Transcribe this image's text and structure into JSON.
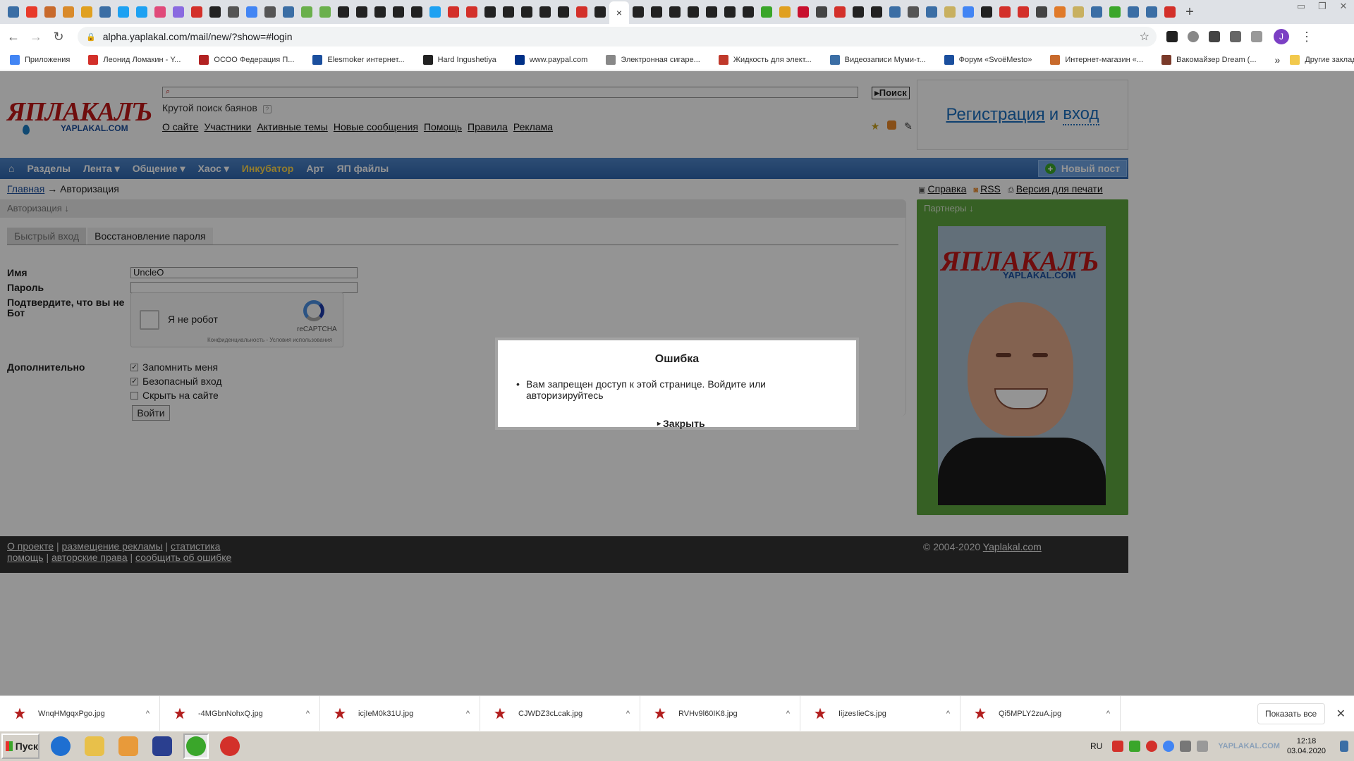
{
  "browser": {
    "close_tab_glyph": "×",
    "new_tab_glyph": "+",
    "url": "alpha.yaplakal.com/mail/new/?show=#login",
    "profile_initial": "J",
    "tab_favicon_colors": [
      "#3b6ea5",
      "#e83a2a",
      "#c86a2c",
      "#d98a2a",
      "#e0a020",
      "#3b6ea5",
      "#1da1f2",
      "#1da1f2",
      "#e04a7a",
      "#8a6ae0",
      "#d3302a",
      "#222222",
      "#555555",
      "#4285f4",
      "#555555",
      "#3b6ea5",
      "#6ab04c",
      "#6ab04c",
      "#222222",
      "#222222",
      "#222222",
      "#222222",
      "#222222",
      "#1da1f2",
      "#d3302a",
      "#d3302a",
      "#222222",
      "#222222",
      "#222222",
      "#222222",
      "#222222",
      "#d3302a",
      "#222222"
    ],
    "tab_favicon_colors_after": [
      "#222222",
      "#222222",
      "#222222",
      "#222222",
      "#222222",
      "#222222",
      "#222222",
      "#3aa62a",
      "#e0a020",
      "#c8102e",
      "#444444",
      "#d3302a",
      "#222222",
      "#222222",
      "#3b6ea5",
      "#555555",
      "#3b6ea5",
      "#c8b060",
      "#4285f4",
      "#222222",
      "#d3302a",
      "#d3302a",
      "#444444",
      "#e07a2a",
      "#c8b060",
      "#3b6ea5",
      "#3aa62a",
      "#3b6ea5",
      "#3b6ea5",
      "#d3302a"
    ]
  },
  "bookmarks": [
    {
      "label": "Приложения",
      "color": "#4285f4"
    },
    {
      "label": "Леонид Ломакин - Y...",
      "color": "#d3302a"
    },
    {
      "label": "ОСОО Федерация П...",
      "color": "#b22222"
    },
    {
      "label": "Elesmoker интернет...",
      "color": "#1b4f9e"
    },
    {
      "label": "Hard Ingushetiya",
      "color": "#222222"
    },
    {
      "label": "www.paypal.com",
      "color": "#003087"
    },
    {
      "label": "Электронная сигаре...",
      "color": "#888888"
    },
    {
      "label": "Жидкость для элект...",
      "color": "#c0392b"
    },
    {
      "label": "Видеозаписи Муми-т...",
      "color": "#3b6ea5"
    },
    {
      "label": "Форум «SvoёMesto»",
      "color": "#1b4f9e"
    },
    {
      "label": "Интернет-магазин «...",
      "color": "#c86a2c"
    },
    {
      "label": "Вакомайзер Dream (...",
      "color": "#7a3a2a"
    }
  ],
  "bookmarks_more": "»",
  "bookmarks_other": "Другие закладки",
  "site": {
    "logo_text": "ЯПЛАКАЛЪ",
    "logo_domain": "YAPLAKAL.COM",
    "search_button": "Поиск",
    "search_hint": "Крутой поиск баянов",
    "search_hint_icon": "?",
    "top_links": [
      "О сайте",
      "Участники",
      "Активные темы",
      "Новые сообщения",
      "Помощь",
      "Правила",
      "Реклама"
    ],
    "register": "Регистрация",
    "and": "и",
    "login": "вход",
    "nav": {
      "home_glyph": "⌂",
      "items": [
        "Разделы",
        "Лента ▾",
        "Общение ▾",
        "Хаос ▾",
        "Инкубатор",
        "Арт",
        "ЯП файлы"
      ],
      "new_post": "Новый пост",
      "new_post_icon": "+"
    },
    "breadcrumb": {
      "home": "Главная",
      "sep": "→",
      "current": "Авторизация"
    },
    "right_links": {
      "help": "Справка",
      "rss": "RSS",
      "print": "Версия для печати"
    },
    "auth": {
      "header": "Авторизация ↓",
      "tabs": [
        "Быстрый вход",
        "Восстановление пароля"
      ],
      "name_label": "Имя",
      "name_value": "UncleO",
      "password_label": "Пароль",
      "captcha_label": "Подтвердите, что вы не Бот",
      "captcha_text": "Я не робот",
      "captcha_brand": "reCAPTCHA",
      "captcha_terms": "Конфиденциальность - Условия использования",
      "extra_label": "Дополнительно",
      "options": [
        {
          "label": "Запомнить меня",
          "checked": true
        },
        {
          "label": "Безопасный вход",
          "checked": true
        },
        {
          "label": "Скрыть на сайте",
          "checked": false
        }
      ],
      "submit": "Войти"
    },
    "partners": {
      "title": "Партнеры ↓",
      "logo": "ЯПЛАКАЛЪ",
      "domain": "YAPLAKAL.COM"
    },
    "footer": {
      "row1": [
        "О проекте",
        "размещение рекламы",
        "статистика"
      ],
      "row2": [
        "помощь",
        "авторские права",
        "сообщить об ошибке"
      ],
      "sep": "|",
      "copyright": "© 2004-2020",
      "copyright_link": "Yaplakal.com"
    }
  },
  "dialog": {
    "title": "Ошибка",
    "message": "Вам запрещен доступ к этой странице. Войдите или авторизируйтесь",
    "close": "Закрыть",
    "close_glyph": "▸"
  },
  "downloads": {
    "files": [
      "WnqHMgqxPgo.jpg",
      "-4MGbnNohxQ.jpg",
      "icjIeM0k31U.jpg",
      "CJWDZ3cLcak.jpg",
      "RVHv9l60IK8.jpg",
      "IijzesIieCs.jpg",
      "Qi5MPLY2zuA.jpg"
    ],
    "chevron": "^",
    "show_all": "Показать все",
    "close_glyph": "✕"
  },
  "taskbar": {
    "start": "Пуск",
    "apps": [
      {
        "name": "ie",
        "color": "#1e6fd1"
      },
      {
        "name": "explorer",
        "color": "#e8c04a"
      },
      {
        "name": "media-player",
        "color": "#e89a3a"
      },
      {
        "name": "save",
        "color": "#2a3f8f"
      },
      {
        "name": "chrome",
        "color": "#3aa62a"
      },
      {
        "name": "opera",
        "color": "#d3302a"
      }
    ],
    "lang": "RU",
    "watermark": "YAPLAKAL.COM",
    "time": "12:18",
    "date": "03.04.2020"
  }
}
